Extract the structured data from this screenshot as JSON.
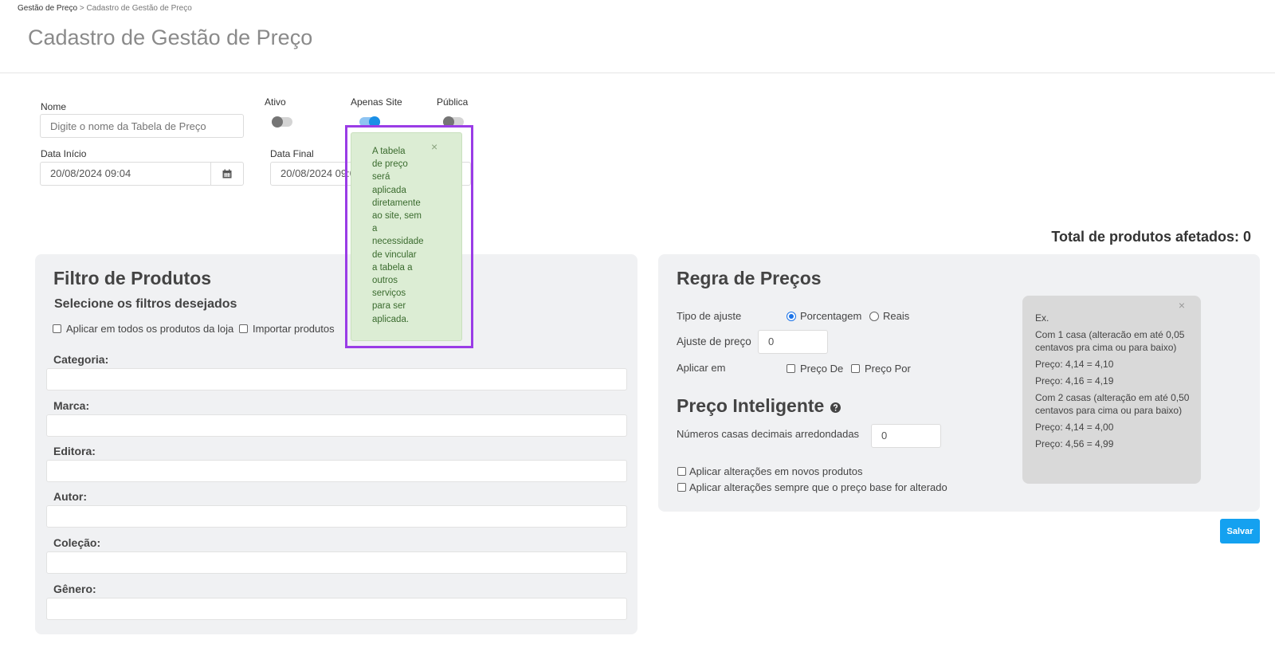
{
  "breadcrumb": {
    "root": "Gestão de Preço",
    "separator": ">",
    "current": "Cadastro de Gestão de Preço"
  },
  "page": {
    "title": "Cadastro de Gestão de Preço"
  },
  "form": {
    "nome": {
      "label": "Nome",
      "placeholder": "Digite o nome da Tabela de Preço",
      "value": ""
    },
    "ativo": {
      "label": "Ativo",
      "checked": false
    },
    "apenas_site": {
      "label": "Apenas Site",
      "checked": true
    },
    "publica": {
      "label": "Pública",
      "checked": false
    },
    "data_inicio": {
      "label": "Data Início",
      "value": "20/08/2024 09:04"
    },
    "data_final": {
      "label": "Data Final",
      "value": "20/08/2024 09:0"
    }
  },
  "tooltip": {
    "text": "A tabela\nde preço\nserá\naplicada\ndiretamente\nao site, sem\na\nnecessidade\nde vincular\na tabela a\noutros\nserviços\npara ser\naplicada.",
    "close": "×"
  },
  "total": {
    "label": "Total de produtos afetados: 0"
  },
  "filtro": {
    "title": "Filtro de Produtos",
    "subtitle": "Selecione os filtros desejados",
    "option_all": "Aplicar em todos os produtos da loja",
    "option_import": "Importar produtos",
    "fields": [
      "Categoria:",
      "Marca:",
      "Editora:",
      "Autor:",
      "Coleção:",
      "Gênero:"
    ]
  },
  "regra": {
    "title": "Regra de Preços",
    "tipo_ajuste": {
      "label": "Tipo de ajuste",
      "options": [
        "Porcentagem",
        "Reais"
      ],
      "selected": "Porcentagem"
    },
    "ajuste_preco": {
      "label": "Ajuste de preço",
      "value": "0"
    },
    "aplicar_em": {
      "label": "Aplicar em",
      "options": [
        "Preço De",
        "Preço Por"
      ]
    },
    "inteligente": {
      "title": "Preço Inteligente",
      "casas_label": "Números casas decimais arredondadas",
      "casas_value": "0",
      "opt_novos": "Aplicar alterações em novos produtos",
      "opt_sempre": "Aplicar alterações sempre que o preço base for alterado"
    },
    "example": {
      "close": "×",
      "lines": [
        "Ex.",
        "Com 1 casa (alteracão em até 0,05 centavos pra cima ou para baixo)",
        "Preço: 4,14 = 4,10",
        "Preço: 4,16 = 4,19",
        "Com 2 casas (alteração em até 0,50 centavos para cima ou para baixo)",
        "Preço: 4,14 = 4,00",
        "Preço: 4,56 = 4,99"
      ]
    }
  },
  "actions": {
    "save_label": "Salvar"
  },
  "icons": {
    "calendar": "calendar-icon",
    "help": "question-circle-icon",
    "close": "close-icon"
  },
  "colors": {
    "primary": "#14a1f0",
    "tooltip_bg": "#dcedd4",
    "highlight": "#9a3ce6",
    "panel_bg": "#f0f1f3"
  }
}
